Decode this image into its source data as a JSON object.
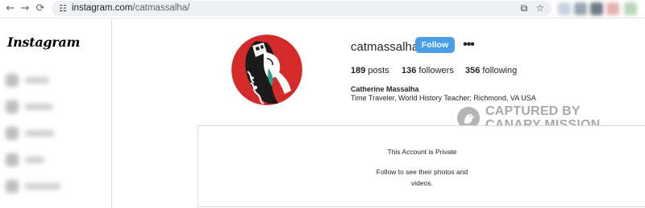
{
  "browser": {
    "back_icon": "back-arrow-icon",
    "forward_icon": "forward-arrow-icon",
    "reload_icon": "reload-icon",
    "url_host": "instagram.com",
    "url_path": "/catmassalha/"
  },
  "sidebar": {
    "logo": "Instagram"
  },
  "profile": {
    "username": "catmassalha",
    "follow_label": "Follow",
    "posts_count": "189",
    "posts_label": "posts",
    "followers_count": "136",
    "followers_label": "followers",
    "following_count": "356",
    "following_label": "following",
    "full_name": "Catherine Massalha",
    "bio": "Time Traveler, World History Teacher; Richmond, VA USA"
  },
  "watermark": {
    "line1": "CAPTURED BY",
    "line2": "CANARY MISSION"
  },
  "private_notice": {
    "title": "This Account is Private",
    "subtitle": "Follow to see their photos and videos."
  },
  "colors": {
    "follow_button": "#4a9ee8",
    "avatar_bg": "#d42a2a",
    "watermark": "#a9a9a9"
  }
}
